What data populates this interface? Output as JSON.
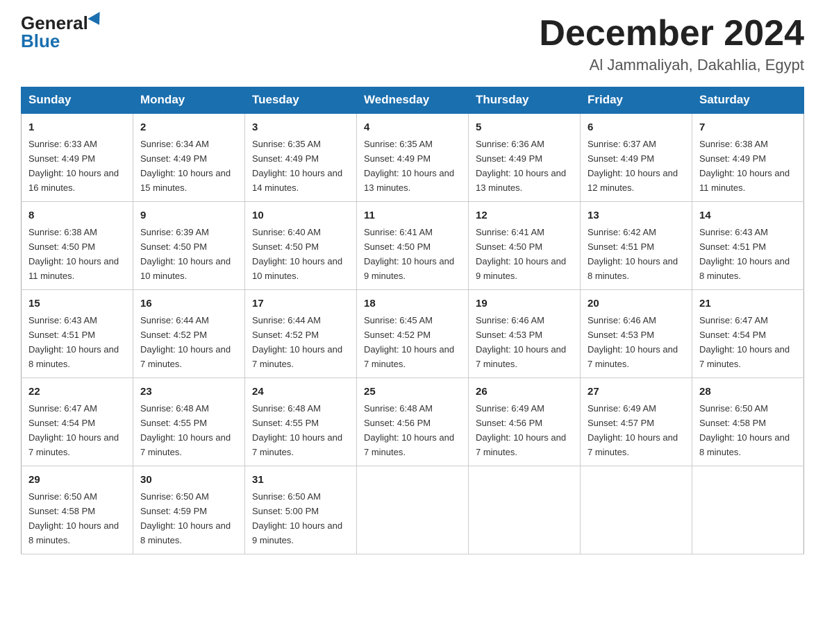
{
  "header": {
    "logo_general": "General",
    "logo_blue": "Blue",
    "month_title": "December 2024",
    "location": "Al Jammaliyah, Dakahlia, Egypt"
  },
  "weekdays": [
    "Sunday",
    "Monday",
    "Tuesday",
    "Wednesday",
    "Thursday",
    "Friday",
    "Saturday"
  ],
  "weeks": [
    [
      {
        "day": "1",
        "sunrise": "6:33 AM",
        "sunset": "4:49 PM",
        "daylight": "10 hours and 16 minutes."
      },
      {
        "day": "2",
        "sunrise": "6:34 AM",
        "sunset": "4:49 PM",
        "daylight": "10 hours and 15 minutes."
      },
      {
        "day": "3",
        "sunrise": "6:35 AM",
        "sunset": "4:49 PM",
        "daylight": "10 hours and 14 minutes."
      },
      {
        "day": "4",
        "sunrise": "6:35 AM",
        "sunset": "4:49 PM",
        "daylight": "10 hours and 13 minutes."
      },
      {
        "day": "5",
        "sunrise": "6:36 AM",
        "sunset": "4:49 PM",
        "daylight": "10 hours and 13 minutes."
      },
      {
        "day": "6",
        "sunrise": "6:37 AM",
        "sunset": "4:49 PM",
        "daylight": "10 hours and 12 minutes."
      },
      {
        "day": "7",
        "sunrise": "6:38 AM",
        "sunset": "4:49 PM",
        "daylight": "10 hours and 11 minutes."
      }
    ],
    [
      {
        "day": "8",
        "sunrise": "6:38 AM",
        "sunset": "4:50 PM",
        "daylight": "10 hours and 11 minutes."
      },
      {
        "day": "9",
        "sunrise": "6:39 AM",
        "sunset": "4:50 PM",
        "daylight": "10 hours and 10 minutes."
      },
      {
        "day": "10",
        "sunrise": "6:40 AM",
        "sunset": "4:50 PM",
        "daylight": "10 hours and 10 minutes."
      },
      {
        "day": "11",
        "sunrise": "6:41 AM",
        "sunset": "4:50 PM",
        "daylight": "10 hours and 9 minutes."
      },
      {
        "day": "12",
        "sunrise": "6:41 AM",
        "sunset": "4:50 PM",
        "daylight": "10 hours and 9 minutes."
      },
      {
        "day": "13",
        "sunrise": "6:42 AM",
        "sunset": "4:51 PM",
        "daylight": "10 hours and 8 minutes."
      },
      {
        "day": "14",
        "sunrise": "6:43 AM",
        "sunset": "4:51 PM",
        "daylight": "10 hours and 8 minutes."
      }
    ],
    [
      {
        "day": "15",
        "sunrise": "6:43 AM",
        "sunset": "4:51 PM",
        "daylight": "10 hours and 8 minutes."
      },
      {
        "day": "16",
        "sunrise": "6:44 AM",
        "sunset": "4:52 PM",
        "daylight": "10 hours and 7 minutes."
      },
      {
        "day": "17",
        "sunrise": "6:44 AM",
        "sunset": "4:52 PM",
        "daylight": "10 hours and 7 minutes."
      },
      {
        "day": "18",
        "sunrise": "6:45 AM",
        "sunset": "4:52 PM",
        "daylight": "10 hours and 7 minutes."
      },
      {
        "day": "19",
        "sunrise": "6:46 AM",
        "sunset": "4:53 PM",
        "daylight": "10 hours and 7 minutes."
      },
      {
        "day": "20",
        "sunrise": "6:46 AM",
        "sunset": "4:53 PM",
        "daylight": "10 hours and 7 minutes."
      },
      {
        "day": "21",
        "sunrise": "6:47 AM",
        "sunset": "4:54 PM",
        "daylight": "10 hours and 7 minutes."
      }
    ],
    [
      {
        "day": "22",
        "sunrise": "6:47 AM",
        "sunset": "4:54 PM",
        "daylight": "10 hours and 7 minutes."
      },
      {
        "day": "23",
        "sunrise": "6:48 AM",
        "sunset": "4:55 PM",
        "daylight": "10 hours and 7 minutes."
      },
      {
        "day": "24",
        "sunrise": "6:48 AM",
        "sunset": "4:55 PM",
        "daylight": "10 hours and 7 minutes."
      },
      {
        "day": "25",
        "sunrise": "6:48 AM",
        "sunset": "4:56 PM",
        "daylight": "10 hours and 7 minutes."
      },
      {
        "day": "26",
        "sunrise": "6:49 AM",
        "sunset": "4:56 PM",
        "daylight": "10 hours and 7 minutes."
      },
      {
        "day": "27",
        "sunrise": "6:49 AM",
        "sunset": "4:57 PM",
        "daylight": "10 hours and 7 minutes."
      },
      {
        "day": "28",
        "sunrise": "6:50 AM",
        "sunset": "4:58 PM",
        "daylight": "10 hours and 8 minutes."
      }
    ],
    [
      {
        "day": "29",
        "sunrise": "6:50 AM",
        "sunset": "4:58 PM",
        "daylight": "10 hours and 8 minutes."
      },
      {
        "day": "30",
        "sunrise": "6:50 AM",
        "sunset": "4:59 PM",
        "daylight": "10 hours and 8 minutes."
      },
      {
        "day": "31",
        "sunrise": "6:50 AM",
        "sunset": "5:00 PM",
        "daylight": "10 hours and 9 minutes."
      },
      null,
      null,
      null,
      null
    ]
  ]
}
